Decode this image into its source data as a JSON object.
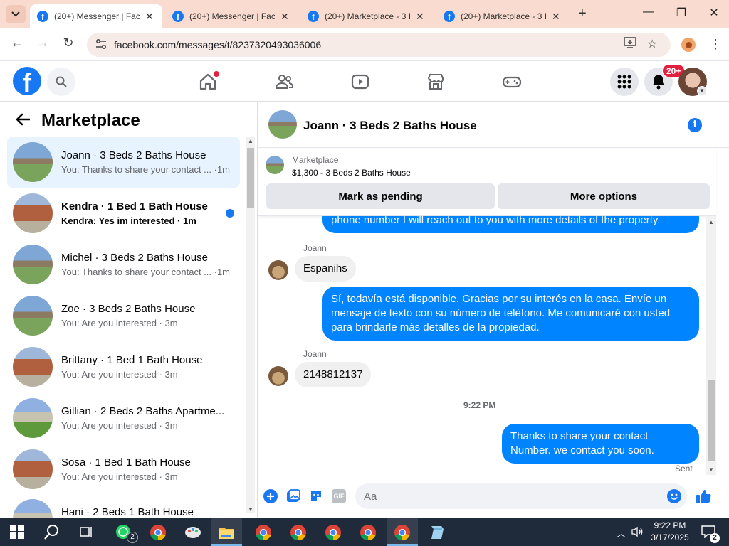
{
  "browser": {
    "tabs": [
      {
        "title": "(20+) Messenger | Face",
        "active": true
      },
      {
        "title": "(20+) Messenger | Face",
        "active": false
      },
      {
        "title": "(20+) Marketplace - 3 I",
        "active": false
      },
      {
        "title": "(20+) Marketplace - 3 I",
        "active": false
      }
    ],
    "url": "facebook.com/messages/t/8237320493036006"
  },
  "header": {
    "logo": "f",
    "notifications_badge": "20+"
  },
  "sidebar": {
    "title": "Marketplace",
    "conversations": [
      {
        "name": "Joann · 3 Beds 2 Baths House",
        "snippet": "You: Thanks to share your contact ... ·1m",
        "unread": false,
        "active": true,
        "thumb": "house-a"
      },
      {
        "name": "Kendra · 1 Bed 1 Bath House",
        "snippet": "Kendra: Yes im interested · 1m",
        "unread": true,
        "active": false,
        "thumb": "house-b"
      },
      {
        "name": "Michel · 3 Beds 2 Baths House",
        "snippet": "You: Thanks to share your contact ... ·1m",
        "unread": false,
        "active": false,
        "thumb": "house-a"
      },
      {
        "name": "Zoe · 3 Beds 2 Baths House",
        "snippet": "You: Are you interested · 3m",
        "unread": false,
        "active": false,
        "thumb": "house-a"
      },
      {
        "name": "Brittany · 1 Bed 1 Bath House",
        "snippet": "You: Are you interested · 3m",
        "unread": false,
        "active": false,
        "thumb": "house-b"
      },
      {
        "name": "Gillian · 2 Beds 2 Baths Apartme...",
        "snippet": "You: Are you interested · 3m",
        "unread": false,
        "active": false,
        "thumb": "house-c"
      },
      {
        "name": "Sosa · 1 Bed 1 Bath House",
        "snippet": "You: Are you interested · 3m",
        "unread": false,
        "active": false,
        "thumb": "house-b"
      },
      {
        "name": "Hani · 2 Beds 1 Bath House",
        "snippet": "",
        "unread": false,
        "active": false,
        "thumb": "house-c"
      }
    ]
  },
  "chat": {
    "title": "Joann · 3 Beds 2 Baths House",
    "listing": {
      "label": "Marketplace",
      "price_title": "$1,300 - 3 Beds 2 Baths House",
      "mark_pending": "Mark as pending",
      "more_options": "More options"
    },
    "messages": {
      "out1_tail": "phone number  I will reach out to you with more details of the property.",
      "sender1": "Joann",
      "in1": "Espanihs",
      "out2": "Sí, todavía está disponible. Gracias por su interés en la casa. Envíe un mensaje de texto con su número de teléfono. Me comunicaré con usted para brindarle más detalles de la propiedad.",
      "sender2": "Joann",
      "in2": "2148812137",
      "timestamp": "9:22 PM",
      "out3": "Thanks to share your contact Number. we contact you soon.",
      "status": "Sent"
    },
    "composer": {
      "placeholder": "Aa",
      "gif": "GIF"
    }
  },
  "taskbar": {
    "time": "9:22 PM",
    "date": "3/17/2025",
    "whatsapp_badge": "2",
    "notif_count": "2"
  },
  "colors": {
    "brand": "#1877f2",
    "bubble_out": "#0084ff",
    "unread": "#1877f2",
    "badge": "#e41e3f"
  }
}
